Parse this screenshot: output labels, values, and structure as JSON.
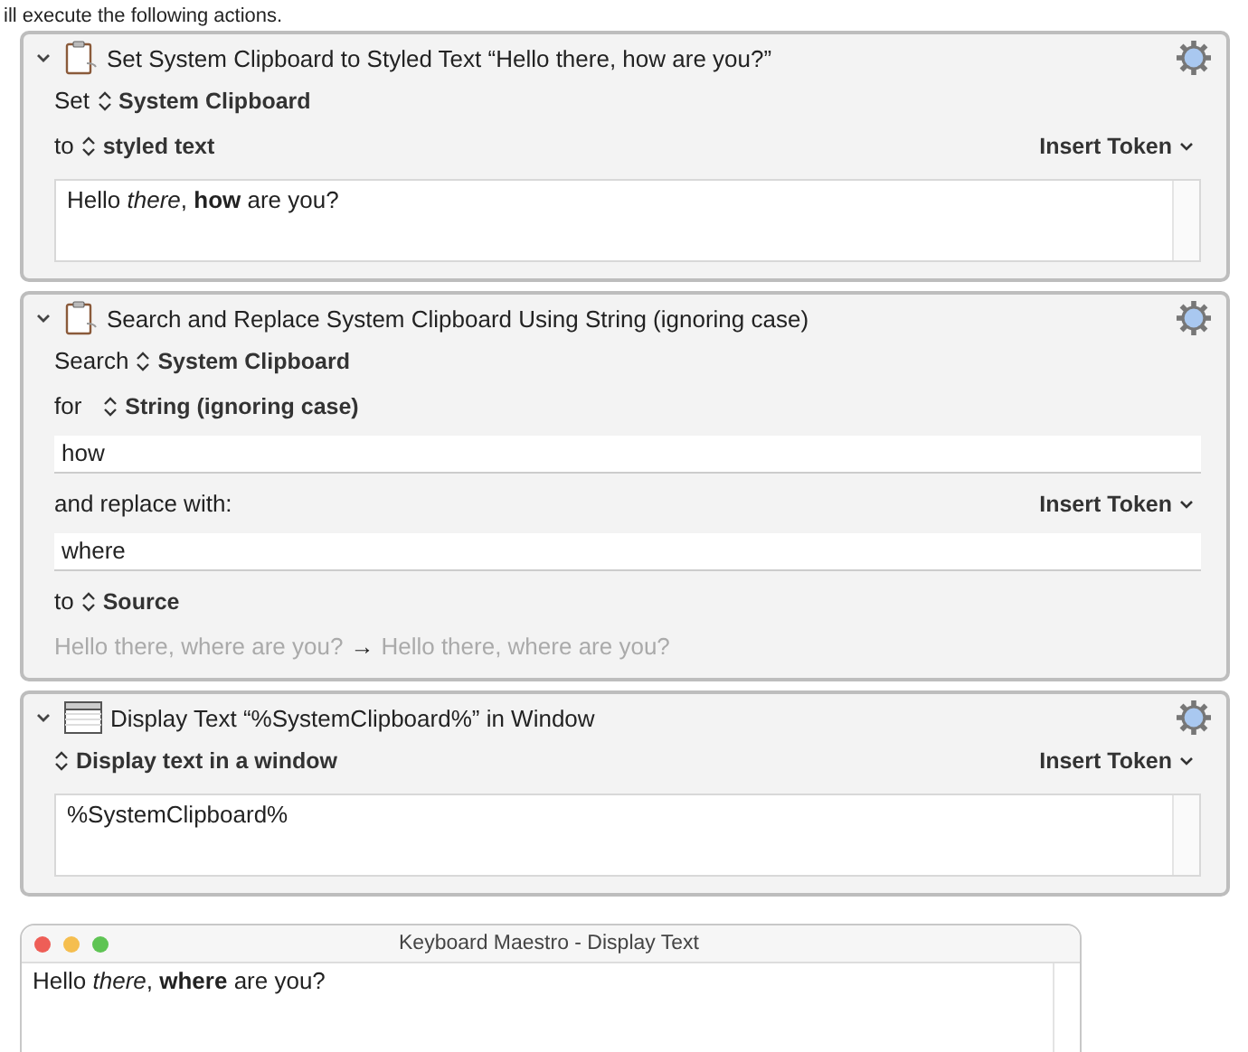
{
  "header": "ill execute the following actions.",
  "actions": [
    {
      "kind": "clipboard",
      "title": "Set System Clipboard to Styled Text “Hello there, how are you?”",
      "expanded": true,
      "rows": [
        {
          "kind": "popup",
          "label": "Set",
          "value": "System Clipboard"
        },
        {
          "kind": "popup",
          "label": "to",
          "value": "styled text",
          "token": "Insert Token"
        },
        {
          "kind": "textarea",
          "value": "Hello *there*, **how** are you?"
        }
      ]
    },
    {
      "kind": "clipboard",
      "title": "Search and Replace System Clipboard Using String (ignoring case)",
      "expanded": true,
      "rows": [
        {
          "kind": "popup",
          "label": "Search",
          "value": "System Clipboard"
        },
        {
          "kind": "popup",
          "label": "for",
          "value": "String (ignoring case)"
        },
        {
          "kind": "input",
          "value": "how"
        },
        {
          "kind": "label",
          "label": "and replace with:",
          "token": "Insert Token"
        },
        {
          "kind": "input",
          "value": "where"
        },
        {
          "kind": "popup",
          "label": "to",
          "value": "Source"
        },
        {
          "kind": "preview",
          "before": "Hello there, where are you?",
          "arrow": "→",
          "after": "Hello there, where are you?"
        }
      ]
    },
    {
      "kind": "window",
      "title": "Display Text “%SystemClipboard%” in Window",
      "expanded": true,
      "rows": [
        {
          "kind": "popup",
          "value": "Display text in a window",
          "token": "Insert Token"
        },
        {
          "kind": "textarea",
          "value": "%SystemClipboard%"
        }
      ]
    }
  ],
  "display_window": {
    "title": "Keyboard Maestro - Display Text",
    "text": "Hello *there*, **where** are you?"
  }
}
